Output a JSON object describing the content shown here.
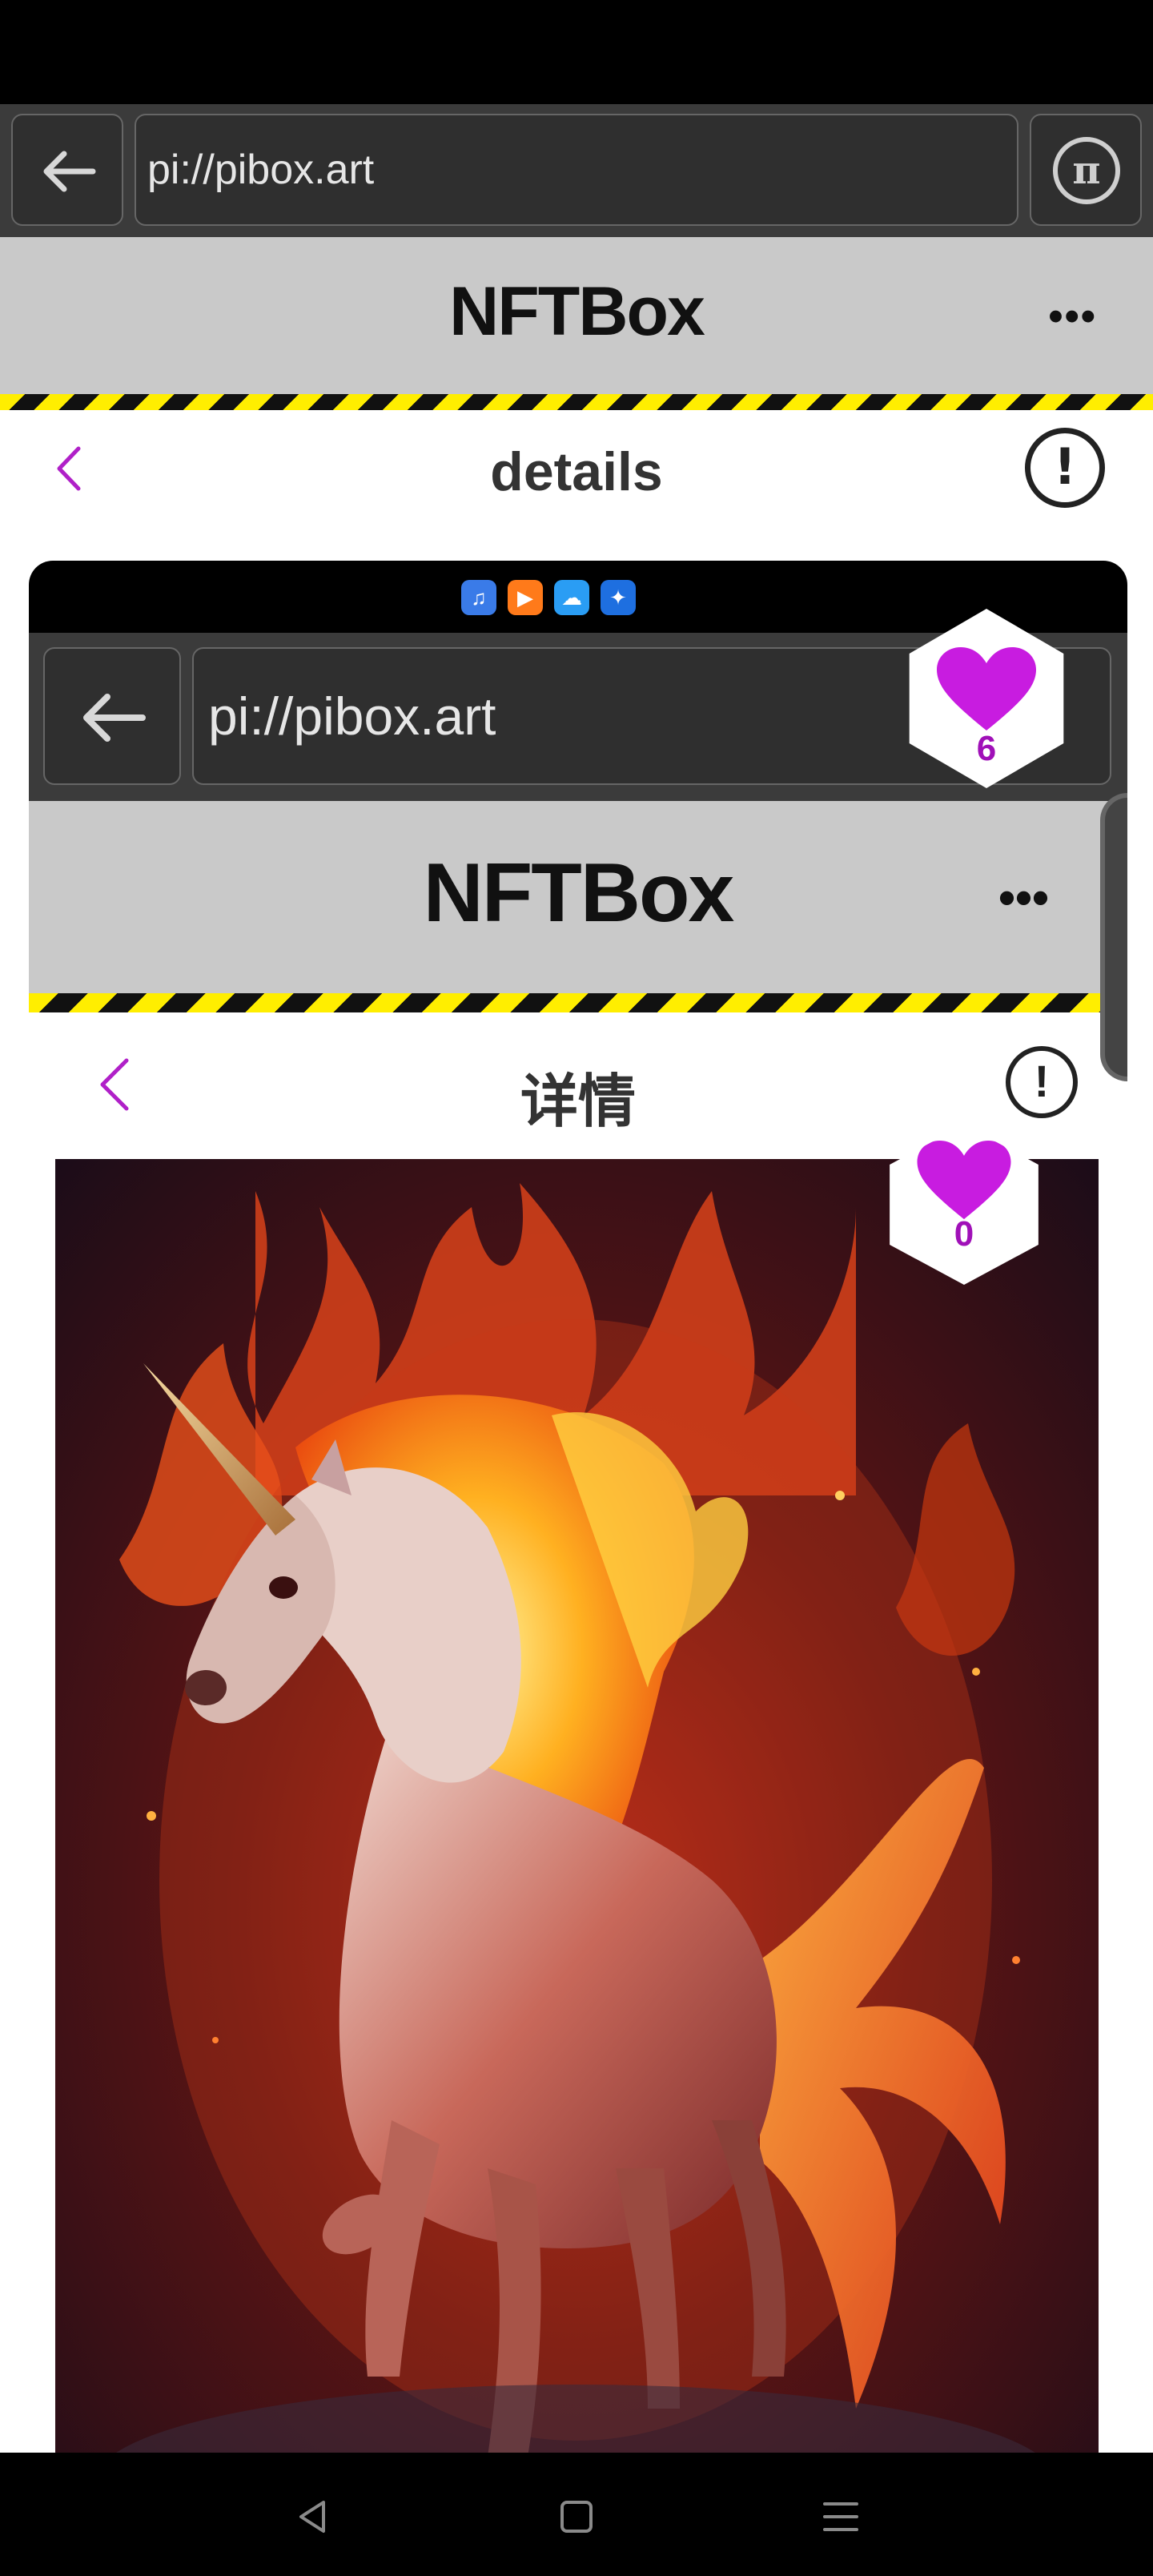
{
  "browser": {
    "url": "pi://pibox.art",
    "pi_symbol": "π"
  },
  "app": {
    "title": "NFTBox",
    "more": "•••"
  },
  "page": {
    "title": "details"
  },
  "info_symbol": "!",
  "like_badge": {
    "count": "6"
  },
  "embedded_screenshot": {
    "browser": {
      "url": "pi://pibox.art"
    },
    "app": {
      "title": "NFTBox",
      "more": "•••"
    },
    "page": {
      "title": "详情"
    },
    "info_symbol": "!",
    "like_badge": {
      "count": "0"
    }
  },
  "colors": {
    "accent": "#b020c8",
    "heart": "#c81ce0",
    "header_bg": "#c9c9c9",
    "hazard_yellow": "#ffee00"
  },
  "icons": [
    "back-arrow-icon",
    "pi-logo-icon",
    "more-icon",
    "chevron-left-icon",
    "info-icon",
    "heart-icon",
    "nav-back-icon",
    "nav-home-icon",
    "nav-menu-icon"
  ]
}
